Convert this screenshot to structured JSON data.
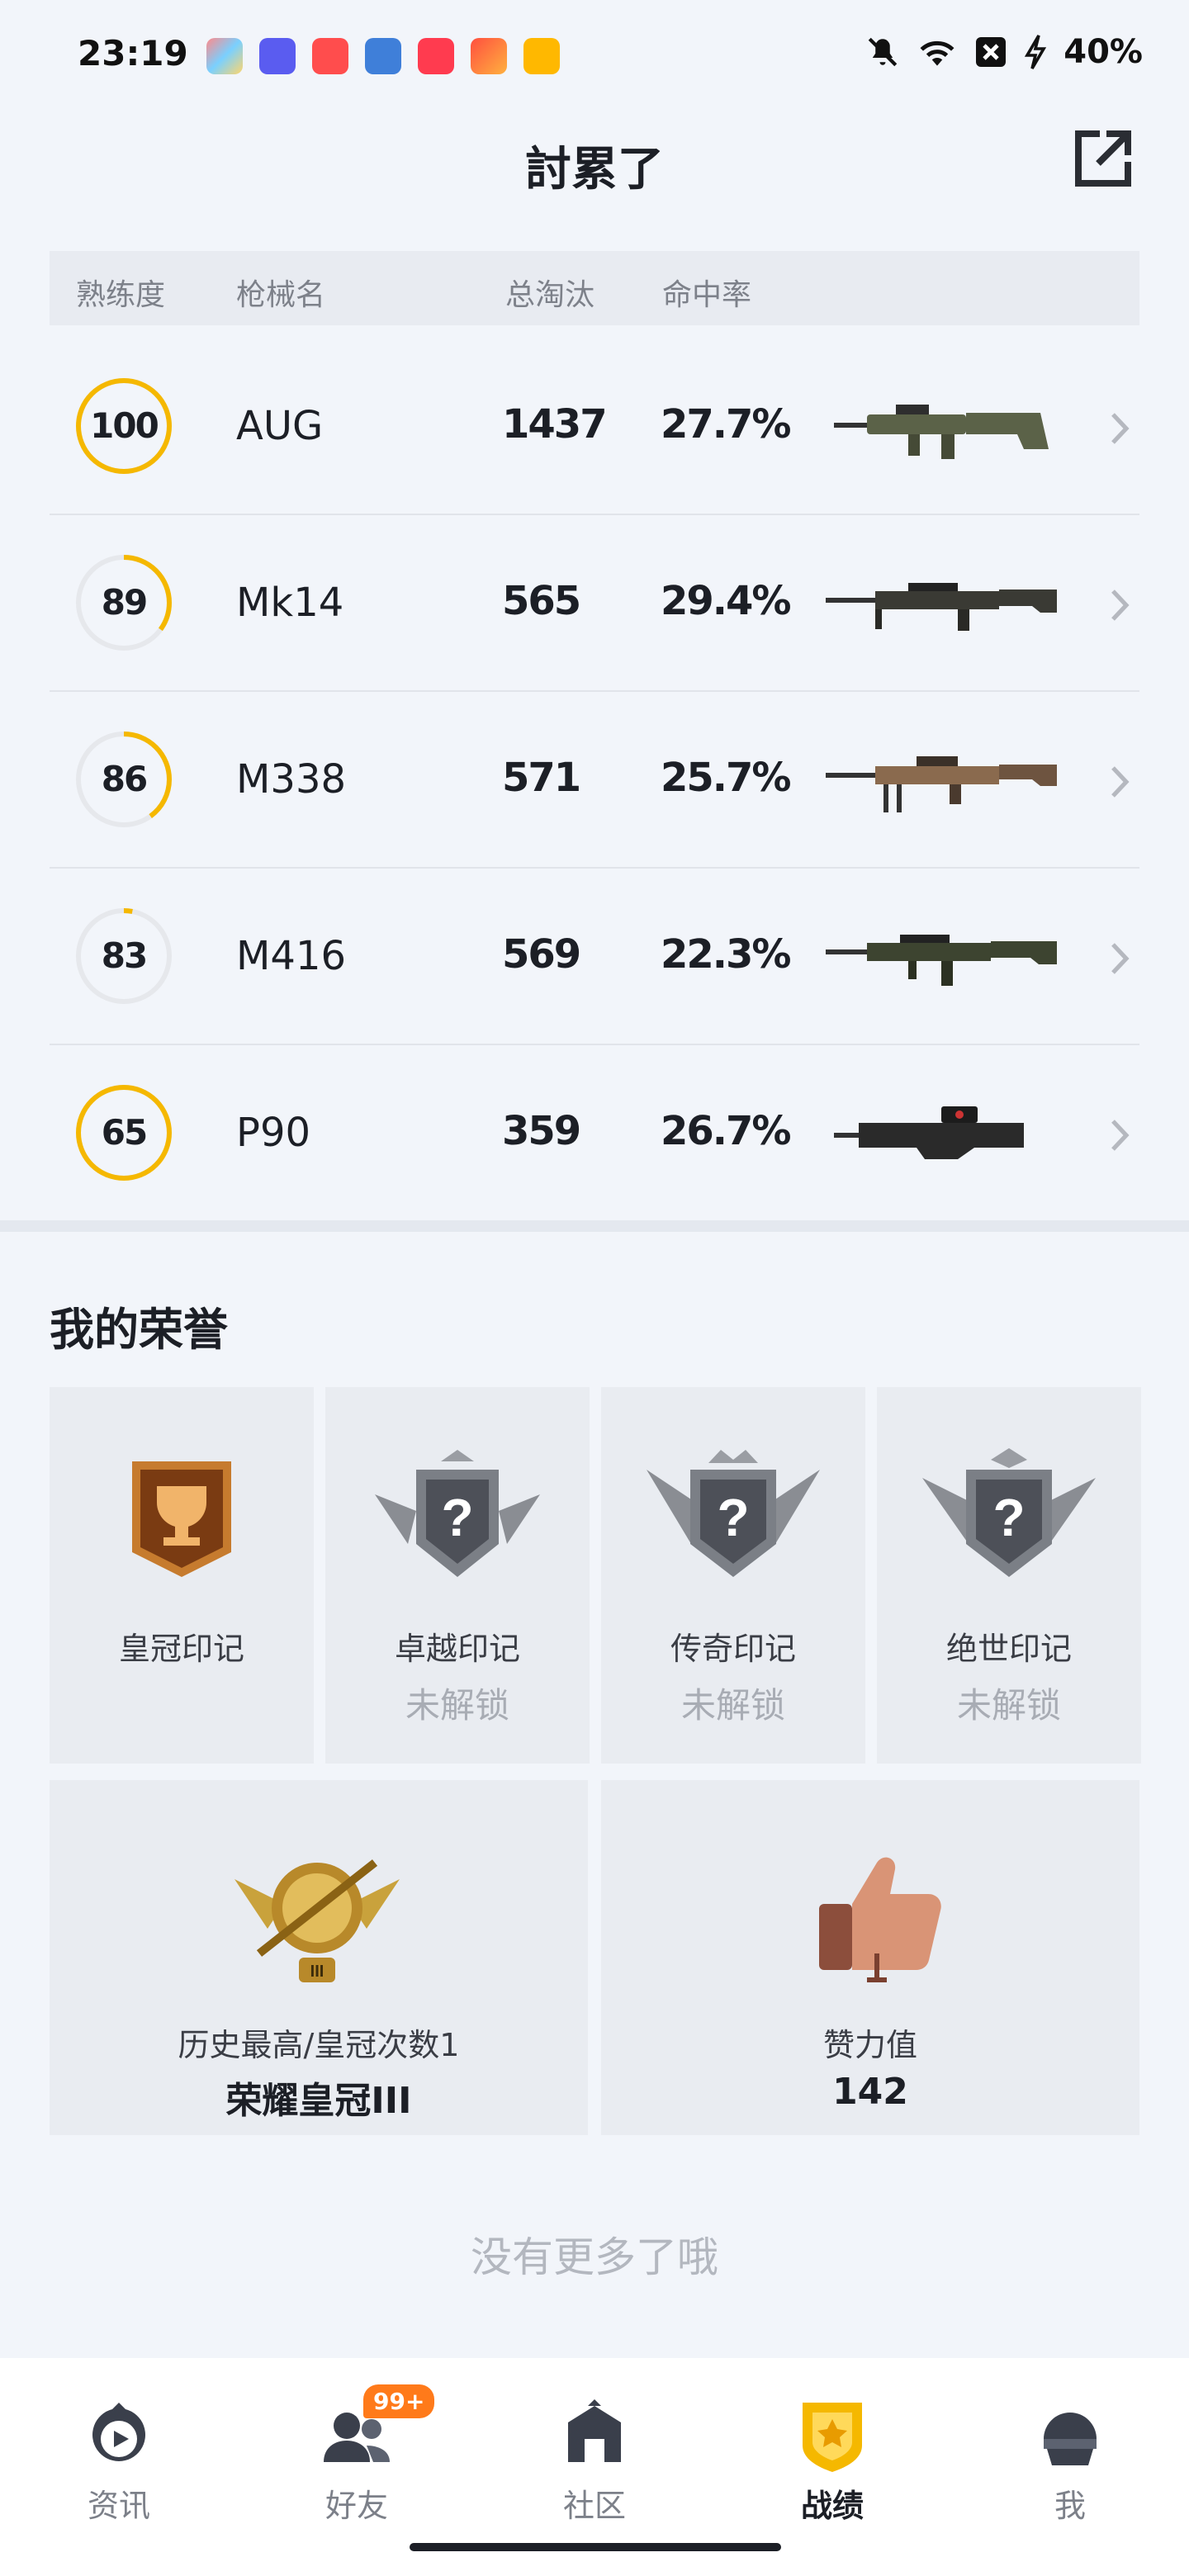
{
  "status_bar": {
    "time": "23:19",
    "battery": "40%",
    "icons": [
      "app-icon-1",
      "app-icon-2",
      "app-icon-3",
      "app-icon-4",
      "app-icon-5",
      "app-icon-6",
      "app-icon-7",
      "mute-icon",
      "wifi-icon",
      "sim-off-icon",
      "charging-icon"
    ]
  },
  "header": {
    "title": "討累了"
  },
  "table": {
    "headers": {
      "mastery": "熟练度",
      "gun_name": "枪械名",
      "kills": "总淘汰",
      "accuracy": "命中率"
    },
    "rows": [
      {
        "mastery": "100",
        "mastery_fraction": 1.0,
        "name": "AUG",
        "kills": "1437",
        "accuracy": "27.7%"
      },
      {
        "mastery": "89",
        "mastery_fraction": 0.35,
        "name": "Mk14",
        "kills": "565",
        "accuracy": "29.4%"
      },
      {
        "mastery": "86",
        "mastery_fraction": 0.4,
        "name": "M338",
        "kills": "571",
        "accuracy": "25.7%"
      },
      {
        "mastery": "83",
        "mastery_fraction": 0.03,
        "name": "M416",
        "kills": "569",
        "accuracy": "22.3%"
      },
      {
        "mastery": "65",
        "mastery_fraction": 1.0,
        "name": "P90",
        "kills": "359",
        "accuracy": "26.7%"
      }
    ]
  },
  "honors": {
    "title": "我的荣誉",
    "badges": [
      {
        "label": "皇冠印记",
        "status": ""
      },
      {
        "label": "卓越印记",
        "status": "未解锁"
      },
      {
        "label": "传奇印记",
        "status": "未解锁"
      },
      {
        "label": "绝世印记",
        "status": "未解锁"
      }
    ],
    "stats": [
      {
        "subtitle": "历史最高/皇冠次数1",
        "value": "荣耀皇冠III"
      },
      {
        "subtitle": "赞力值",
        "value": "142"
      }
    ]
  },
  "footer_text": "没有更多了哦",
  "nav": {
    "items": [
      {
        "label": "资讯"
      },
      {
        "label": "好友",
        "badge": "99+"
      },
      {
        "label": "社区"
      },
      {
        "label": "战绩"
      },
      {
        "label": "我"
      }
    ],
    "active_index": 3
  },
  "colors": {
    "accent": "#f5b800",
    "background": "#f2f5fa",
    "badge_orange": "#ff7a1a"
  }
}
